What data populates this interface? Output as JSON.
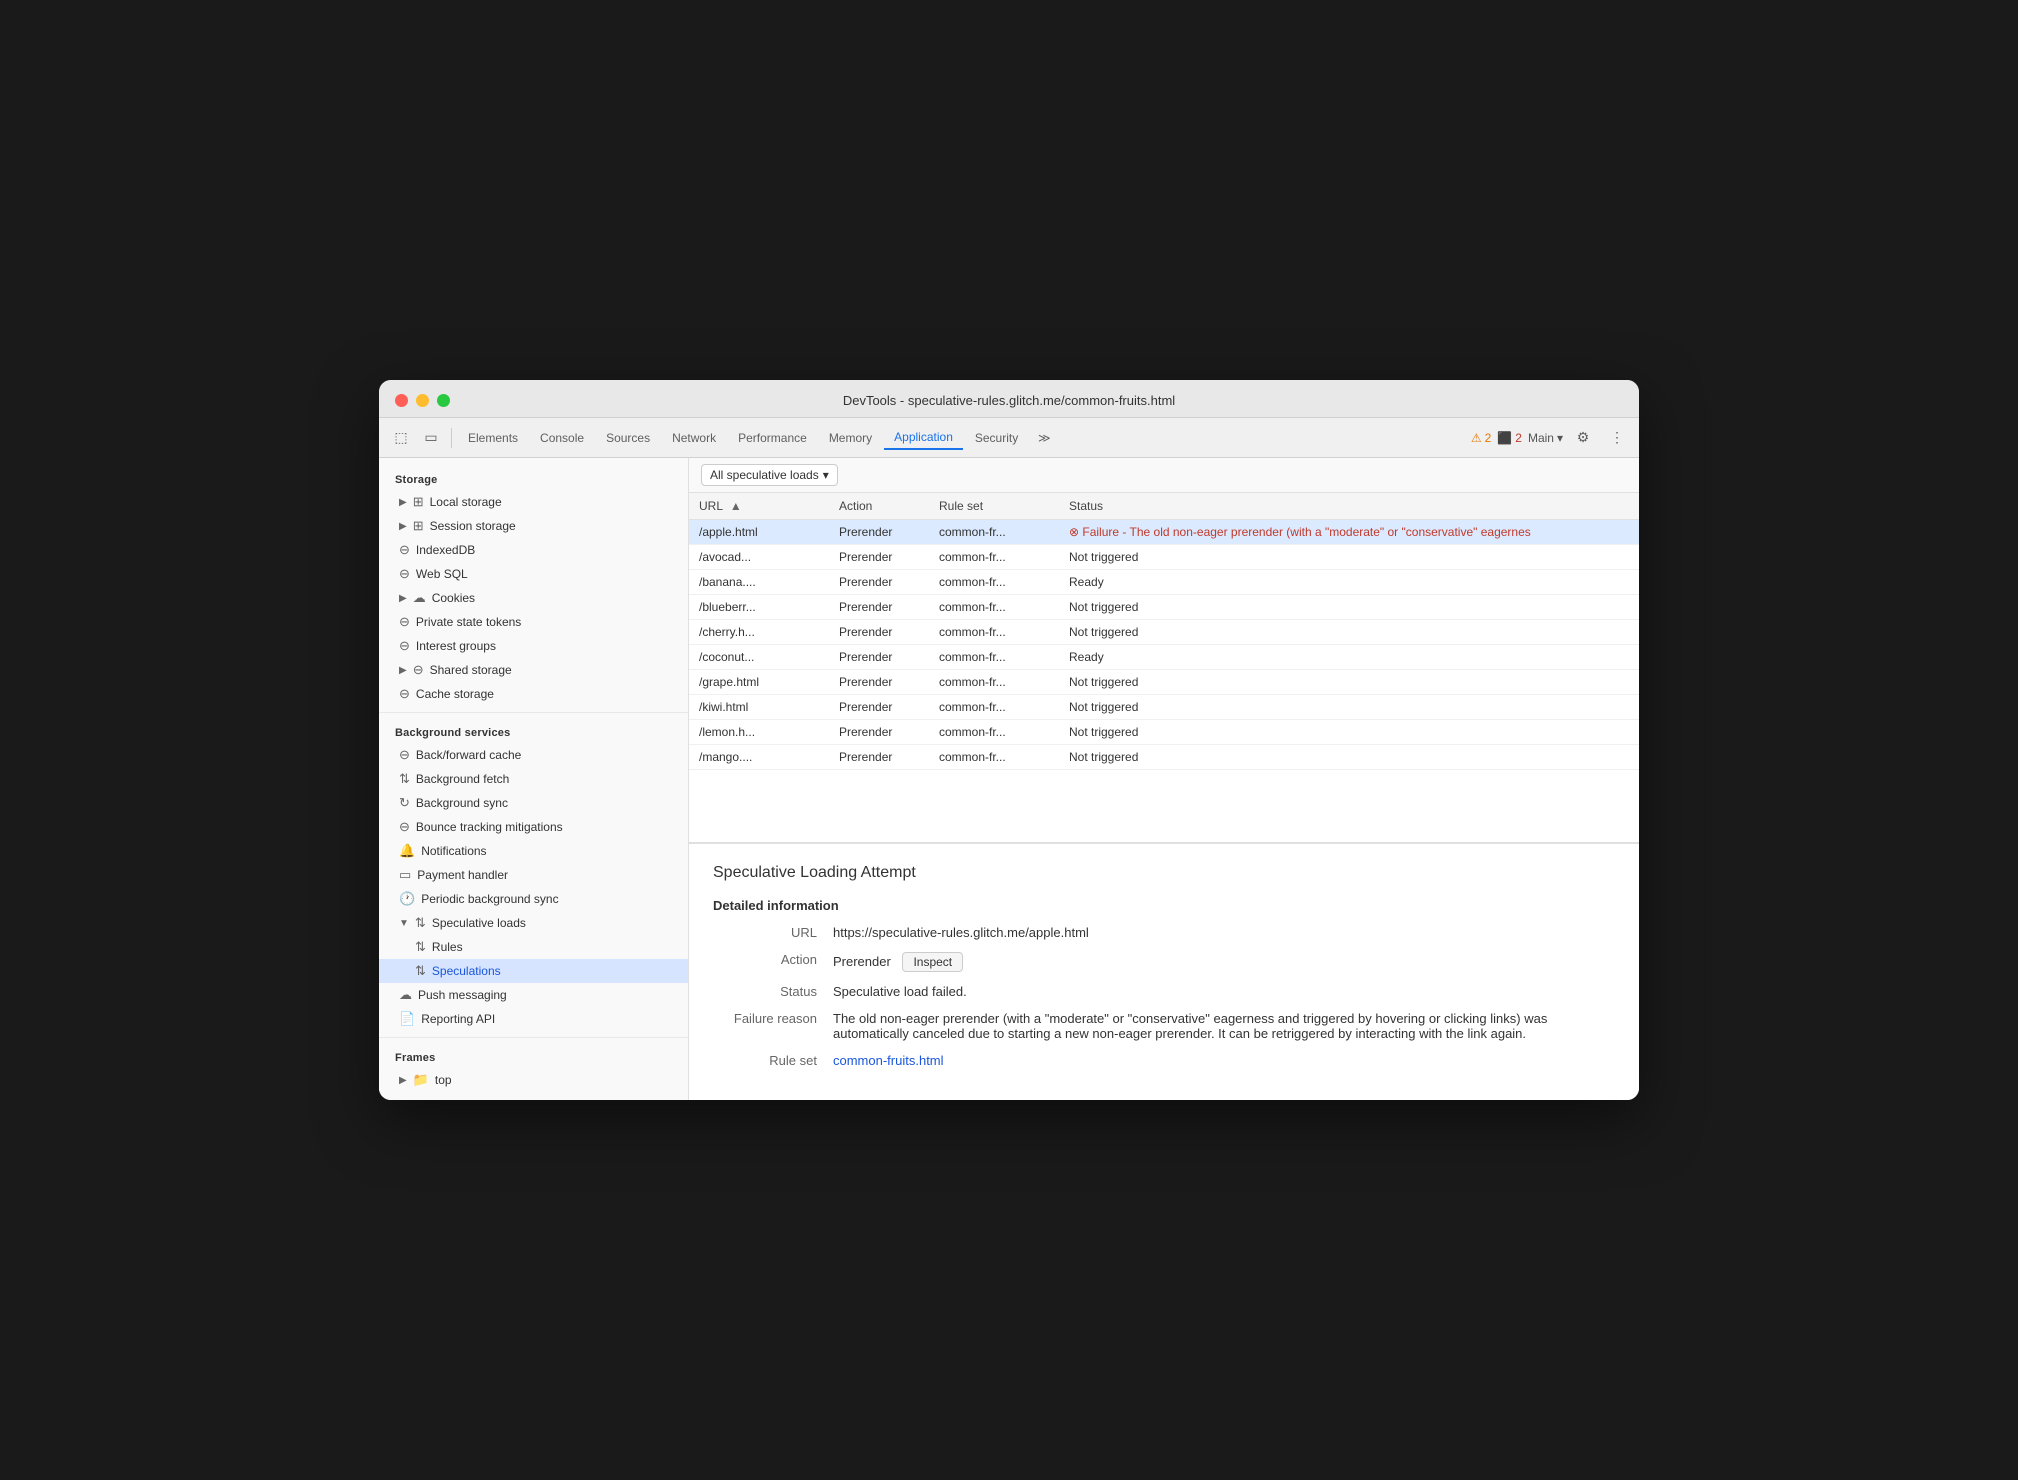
{
  "window": {
    "title": "DevTools - speculative-rules.glitch.me/common-fruits.html"
  },
  "toolbar": {
    "tabs": [
      "Elements",
      "Console",
      "Sources",
      "Network",
      "Performance",
      "Memory",
      "Application",
      "Security"
    ],
    "active_tab": "Application",
    "warnings": "2",
    "errors": "2",
    "context": "Main"
  },
  "sidebar": {
    "storage_section": "Storage",
    "storage_items": [
      {
        "label": "Local storage",
        "icon": "grid",
        "expandable": true,
        "indent": 0
      },
      {
        "label": "Session storage",
        "icon": "grid",
        "expandable": true,
        "indent": 0
      },
      {
        "label": "IndexedDB",
        "icon": "cylinder",
        "expandable": false,
        "indent": 0
      },
      {
        "label": "Web SQL",
        "icon": "cylinder",
        "expandable": false,
        "indent": 0
      },
      {
        "label": "Cookies",
        "icon": "cookie",
        "expandable": true,
        "indent": 0
      },
      {
        "label": "Private state tokens",
        "icon": "cylinder",
        "expandable": false,
        "indent": 0
      },
      {
        "label": "Interest groups",
        "icon": "cylinder",
        "expandable": false,
        "indent": 0
      },
      {
        "label": "Shared storage",
        "icon": "cylinder",
        "expandable": true,
        "indent": 0
      },
      {
        "label": "Cache storage",
        "icon": "cylinder",
        "expandable": false,
        "indent": 0
      }
    ],
    "background_section": "Background services",
    "background_items": [
      {
        "label": "Back/forward cache",
        "icon": "cylinder"
      },
      {
        "label": "Background fetch",
        "icon": "arrow-up-down"
      },
      {
        "label": "Background sync",
        "icon": "sync"
      },
      {
        "label": "Bounce tracking mitigations",
        "icon": "cylinder"
      },
      {
        "label": "Notifications",
        "icon": "bell"
      },
      {
        "label": "Payment handler",
        "icon": "card"
      },
      {
        "label": "Periodic background sync",
        "icon": "clock"
      },
      {
        "label": "Speculative loads",
        "icon": "arrow-up-down",
        "expandable": true,
        "expanded": true
      },
      {
        "label": "Rules",
        "icon": "arrow-up-down",
        "indent": 1
      },
      {
        "label": "Speculations",
        "icon": "arrow-up-down",
        "indent": 1,
        "active": true
      },
      {
        "label": "Push messaging",
        "icon": "cloud"
      },
      {
        "label": "Reporting API",
        "icon": "doc"
      }
    ],
    "frames_section": "Frames",
    "frames_items": [
      {
        "label": "top",
        "icon": "folder",
        "expandable": true
      }
    ]
  },
  "content": {
    "filter": "All speculative loads",
    "table": {
      "columns": [
        "URL",
        "Action",
        "Rule set",
        "Status"
      ],
      "rows": [
        {
          "url": "/apple.html",
          "action": "Prerender",
          "ruleset": "common-fr...",
          "status": "Failure - The old non-eager prerender (with a \"moderate\" or \"conservative\" eagernes",
          "status_type": "fail",
          "selected": true
        },
        {
          "url": "/avocad...",
          "action": "Prerender",
          "ruleset": "common-fr...",
          "status": "Not triggered",
          "status_type": "normal"
        },
        {
          "url": "/banana....",
          "action": "Prerender",
          "ruleset": "common-fr...",
          "status": "Ready",
          "status_type": "normal"
        },
        {
          "url": "/blueberr...",
          "action": "Prerender",
          "ruleset": "common-fr...",
          "status": "Not triggered",
          "status_type": "normal"
        },
        {
          "url": "/cherry.h...",
          "action": "Prerender",
          "ruleset": "common-fr...",
          "status": "Not triggered",
          "status_type": "normal"
        },
        {
          "url": "/coconut...",
          "action": "Prerender",
          "ruleset": "common-fr...",
          "status": "Ready",
          "status_type": "normal"
        },
        {
          "url": "/grape.html",
          "action": "Prerender",
          "ruleset": "common-fr...",
          "status": "Not triggered",
          "status_type": "normal"
        },
        {
          "url": "/kiwi.html",
          "action": "Prerender",
          "ruleset": "common-fr...",
          "status": "Not triggered",
          "status_type": "normal"
        },
        {
          "url": "/lemon.h...",
          "action": "Prerender",
          "ruleset": "common-fr...",
          "status": "Not triggered",
          "status_type": "normal"
        },
        {
          "url": "/mango....",
          "action": "Prerender",
          "ruleset": "common-fr...",
          "status": "Not triggered",
          "status_type": "normal"
        }
      ]
    },
    "detail": {
      "title": "Speculative Loading Attempt",
      "section_title": "Detailed information",
      "url_label": "URL",
      "url_value": "https://speculative-rules.glitch.me/apple.html",
      "action_label": "Action",
      "action_value": "Prerender",
      "inspect_label": "Inspect",
      "status_label": "Status",
      "status_value": "Speculative load failed.",
      "failure_label": "Failure reason",
      "failure_text": "The old non-eager prerender (with a \"moderate\" or \"conservative\" eagerness and triggered by hovering or clicking links) was automatically canceled due to starting a new non-eager prerender. It can be retriggered by interacting with the link again.",
      "ruleset_label": "Rule set",
      "ruleset_link_text": "common-fruits.html",
      "ruleset_link_href": "#"
    }
  }
}
